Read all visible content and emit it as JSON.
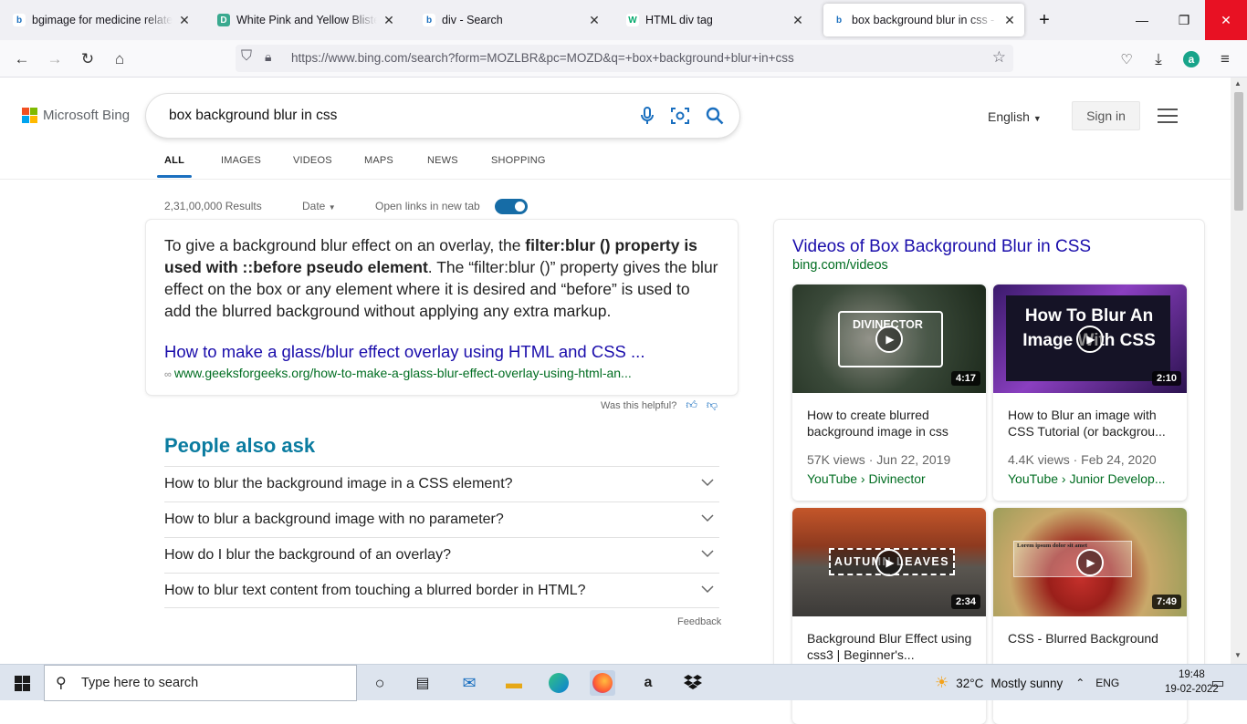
{
  "browser": {
    "tabs": [
      {
        "title": "bgimage for medicine related w",
        "icon": "bing-icon",
        "active": false
      },
      {
        "title": "White Pink and Yellow Blister Pa",
        "icon": "d-site-icon",
        "active": false
      },
      {
        "title": "div - Search",
        "icon": "bing-icon",
        "active": false
      },
      {
        "title": "HTML div tag",
        "icon": "w3schools-icon",
        "active": false
      },
      {
        "title": "box background blur in css - Se",
        "icon": "bing-icon",
        "active": true
      }
    ],
    "url": "https://www.bing.com/search?form=MOZLBR&pc=MOZD&q=+box+background+blur+in+css"
  },
  "bing": {
    "logo_text": "Microsoft Bing",
    "query": "box background blur in css",
    "scopes": [
      "ALL",
      "IMAGES",
      "VIDEOS",
      "MAPS",
      "NEWS",
      "SHOPPING"
    ],
    "language": "English",
    "sign_in": "Sign in"
  },
  "results_meta": {
    "count": "2,31,00,000 Results",
    "date_filter": "Date",
    "open_links": "Open links in new tab"
  },
  "answer": {
    "text_before": "To give a background blur effect on an overlay, the ",
    "text_bold": "filter:blur () property is used with ::before pseudo element",
    "text_after": ". The “filter:blur ()” property gives the blur effect on the box or any element where it is desired and “before” is used to add the blurred background without applying any extra markup.",
    "link_title": "How to make a glass/blur effect overlay using HTML and CSS ...",
    "link_url": "www.geeksforgeeks.org/how-to-make-a-glass-blur-effect-overlay-using-html-an...",
    "helpful": "Was this helpful?"
  },
  "paa": {
    "title": "People also ask",
    "questions": [
      "How to blur the background image in a CSS element?",
      "How to blur a background image with no parameter?",
      "How do I blur the background of an overlay?",
      "How to blur text content from touching a blurred border in HTML?"
    ],
    "feedback": "Feedback"
  },
  "videos": {
    "title": "Videos of Box Background Blur in CSS",
    "source": "bing.com/videos",
    "items": [
      {
        "title": "How to create blurred background image in css",
        "duration": "4:17",
        "views": "57K views",
        "date": "Jun 22, 2019",
        "source": "YouTube › Divinector",
        "thumb_text": "DIVINECTOR"
      },
      {
        "title": "How to Blur an image with CSS Tutorial (or backgrou...",
        "duration": "2:10",
        "views": "4.4K views",
        "date": "Feb 24, 2020",
        "source": "YouTube › Junior Develop...",
        "thumb_text": "How To Blur An Image With CSS"
      },
      {
        "title": "Background Blur Effect using css3 | Beginner's...",
        "duration": "2:34",
        "thumb_text": "AUTUMN LEAVES"
      },
      {
        "title": "CSS - Blurred Background",
        "duration": "7:49",
        "thumb_text": "Lorem ipsum dolor sit amet"
      }
    ]
  },
  "taskbar": {
    "search_placeholder": "Type here to search",
    "temperature": "32°C",
    "weather": "Mostly sunny",
    "lang": "ENG",
    "time": "19:48",
    "date": "19-02-2022"
  }
}
